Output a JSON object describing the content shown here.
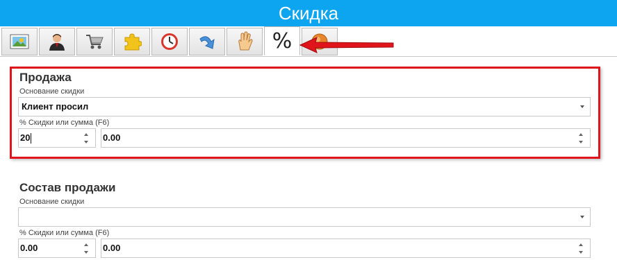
{
  "window": {
    "title": "Скидка"
  },
  "toolbar": {
    "buttons": [
      {
        "icon": "picture-icon"
      },
      {
        "icon": "user-icon"
      },
      {
        "icon": "cart-icon"
      },
      {
        "icon": "puzzle-icon"
      },
      {
        "icon": "clock-icon"
      },
      {
        "icon": "redo-arrow-icon"
      },
      {
        "icon": "hand-icon"
      },
      {
        "icon": "percent-icon",
        "label": "%",
        "active": true
      },
      {
        "icon": "orange-circle-icon"
      }
    ],
    "annotation": "red-arrow-icon"
  },
  "sale": {
    "title": "Продажа",
    "reason_label": "Основание скидки",
    "reason_value": "Клиент просил",
    "discount_label": "% Скидки или сумма (F6)",
    "percent_value": "20",
    "amount_value": "0.00"
  },
  "composition": {
    "title": "Состав продажи",
    "reason_label": "Основание скидки",
    "reason_value": "",
    "discount_label": "% Скидки или сумма (F6)",
    "percent_value": "0.00",
    "amount_value": "0.00"
  },
  "colors": {
    "titlebar": "#0ea5f0",
    "highlight": "#e0151b"
  }
}
